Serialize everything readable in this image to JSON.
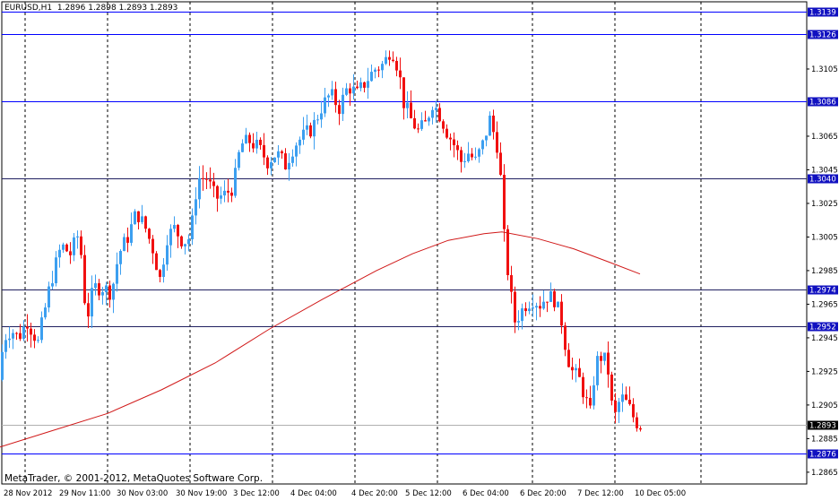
{
  "header": {
    "symbol": "EURUSD,H1",
    "ohlc": "1.2896 1.2898 1.2893 1.2893"
  },
  "footer": {
    "copyright": "MetaTrader, © 2001-2012, MetaQuotes Software Corp."
  },
  "colors": {
    "background": "#ffffff",
    "bull_candle": "#3c9ff0",
    "bear_candle": "#f01010",
    "moving_average": "#d01818",
    "level_line_blue": "#0000ff",
    "level_line_dark": "#202060",
    "grid": "#000000"
  },
  "chart_data": {
    "type": "candlestick",
    "symbol": "EURUSD",
    "timeframe": "H1",
    "ylim": [
      1.2858,
      1.3145
    ],
    "y_ticks": [
      "1.3105",
      "1.3065",
      "1.3045",
      "1.3025",
      "1.3005",
      "1.2985",
      "1.2965",
      "1.2945",
      "1.2925",
      "1.2905",
      "1.2885",
      "1.2865"
    ],
    "x_ticks": [
      "28 Nov 2012",
      "29 Nov 11:00",
      "30 Nov 03:00",
      "30 Nov 19:00",
      "3 Dec 12:00",
      "4 Dec 04:00",
      "4 Dec 20:00",
      "5 Dec 12:00",
      "6 Dec 04:00",
      "6 Dec 20:00",
      "7 Dec 12:00",
      "10 Dec 05:00"
    ],
    "level_lines": [
      {
        "price": 1.3139,
        "label": "1.3139",
        "style": "blue"
      },
      {
        "price": 1.3126,
        "label": "1.3126",
        "style": "blue"
      },
      {
        "price": 1.3086,
        "label": "1.3086",
        "style": "blue"
      },
      {
        "price": 1.304,
        "label": "1.3040",
        "style": "dark"
      },
      {
        "price": 1.2974,
        "label": "1.2974",
        "style": "dark"
      },
      {
        "price": 1.2952,
        "label": "1.2952",
        "style": "dark"
      },
      {
        "price": 1.2876,
        "label": "1.2876",
        "style": "blue"
      }
    ],
    "current_price": {
      "price": 1.2893,
      "label": "1.2893"
    },
    "path_points": [
      [
        0,
        1.292
      ],
      [
        6,
        1.2945
      ],
      [
        14,
        1.295
      ],
      [
        22,
        1.2945
      ],
      [
        32,
        1.2955
      ],
      [
        44,
        1.2942
      ],
      [
        58,
        1.2978
      ],
      [
        70,
        1.3
      ],
      [
        80,
        1.2995
      ],
      [
        90,
        1.3008
      ],
      [
        98,
        1.2955
      ],
      [
        106,
        1.2975
      ],
      [
        116,
        1.2975
      ],
      [
        126,
        1.2972
      ],
      [
        134,
        1.2995
      ],
      [
        144,
        1.3005
      ],
      [
        154,
        1.302
      ],
      [
        164,
        1.301
      ],
      [
        172,
        1.2998
      ],
      [
        180,
        1.298
      ],
      [
        188,
        1.3005
      ],
      [
        196,
        1.301
      ],
      [
        206,
        1.3002
      ],
      [
        214,
        1.3005
      ],
      [
        222,
        1.304
      ],
      [
        232,
        1.304
      ],
      [
        242,
        1.3028
      ],
      [
        252,
        1.303
      ],
      [
        262,
        1.3035
      ],
      [
        270,
        1.306
      ],
      [
        280,
        1.3062
      ],
      [
        290,
        1.3058
      ],
      [
        300,
        1.305
      ],
      [
        310,
        1.3055
      ],
      [
        320,
        1.3048
      ],
      [
        330,
        1.306
      ],
      [
        340,
        1.3065
      ],
      [
        350,
        1.307
      ],
      [
        360,
        1.3082
      ],
      [
        370,
        1.309
      ],
      [
        380,
        1.3082
      ],
      [
        390,
        1.3095
      ],
      [
        400,
        1.309
      ],
      [
        410,
        1.3098
      ],
      [
        420,
        1.3105
      ],
      [
        430,
        1.3108
      ],
      [
        438,
        1.3118
      ],
      [
        446,
        1.3105
      ],
      [
        452,
        1.3085
      ],
      [
        460,
        1.3075
      ],
      [
        468,
        1.3068
      ],
      [
        476,
        1.3072
      ],
      [
        484,
        1.3085
      ],
      [
        492,
        1.3078
      ],
      [
        500,
        1.3068
      ],
      [
        508,
        1.306
      ],
      [
        516,
        1.305
      ],
      [
        524,
        1.3055
      ],
      [
        532,
        1.305
      ],
      [
        540,
        1.306
      ],
      [
        548,
        1.3075
      ],
      [
        556,
        1.306
      ],
      [
        560,
        1.304
      ],
      [
        564,
        1.3005
      ],
      [
        570,
        1.2975
      ],
      [
        576,
        1.2955
      ],
      [
        582,
        1.296
      ],
      [
        588,
        1.2965
      ],
      [
        596,
        1.2968
      ],
      [
        604,
        1.2965
      ],
      [
        612,
        1.297
      ],
      [
        620,
        1.2968
      ],
      [
        628,
        1.2955
      ],
      [
        634,
        1.2935
      ],
      [
        640,
        1.2925
      ],
      [
        648,
        1.292
      ],
      [
        654,
        1.291
      ],
      [
        660,
        1.29
      ],
      [
        666,
        1.293
      ],
      [
        674,
        1.2935
      ],
      [
        680,
        1.2925
      ],
      [
        686,
        1.2895
      ],
      [
        694,
        1.291
      ],
      [
        702,
        1.2905
      ],
      [
        708,
        1.2898
      ],
      [
        714,
        1.2893
      ]
    ],
    "ma_points": [
      [
        0,
        1.288
      ],
      [
        60,
        1.289
      ],
      [
        120,
        1.29
      ],
      [
        180,
        1.2914
      ],
      [
        240,
        1.293
      ],
      [
        300,
        1.295
      ],
      [
        360,
        1.2968
      ],
      [
        420,
        1.2985
      ],
      [
        460,
        1.2995
      ],
      [
        500,
        1.3003
      ],
      [
        540,
        1.3007
      ],
      [
        560,
        1.3008
      ],
      [
        600,
        1.3004
      ],
      [
        640,
        1.2998
      ],
      [
        680,
        1.299
      ],
      [
        714,
        1.2983
      ]
    ]
  }
}
